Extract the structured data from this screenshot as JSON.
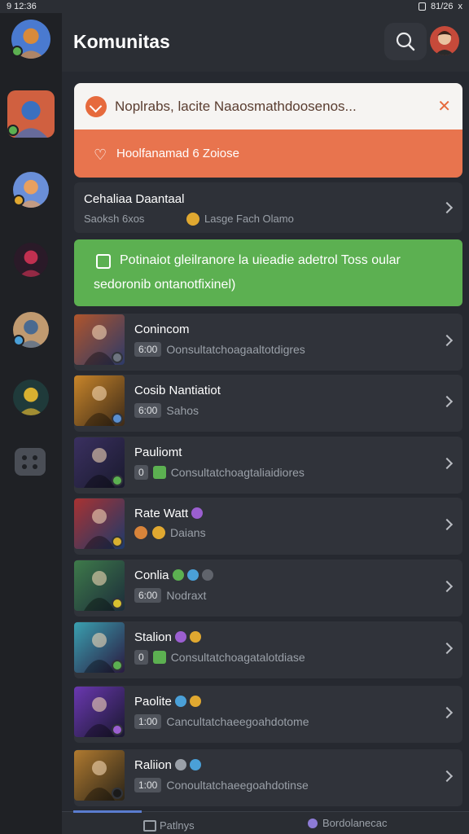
{
  "status_bar": {
    "time": "9 12:36",
    "right": "81/26",
    "close": "x"
  },
  "header": {
    "title": "Komunitas"
  },
  "banner": {
    "title": "Noplrabs, lacite Naaosmathdoosenos...",
    "close": "✕",
    "subtitle": "Hoolfanamad 6 Zoiose"
  },
  "featured": {
    "title": "Cehaliaa Daantaal",
    "meta_left": "Saoksh 6xos",
    "meta_right": "Lasge Fach Olamo"
  },
  "promo": {
    "line1": "Potinaiot gleilranore  la uieadie adetrol Toss oular",
    "line2": "sedoronib ontanotfixinel)"
  },
  "items": [
    {
      "name": "Conincom",
      "tag": "6:00",
      "sub": "Oonsultatchoagaaltotdigres",
      "thumb": "#b0552c",
      "thumb2": "#2c3a68",
      "badge": "#6e7580",
      "name_emojis": []
    },
    {
      "name": "Cosib Nantiatiot",
      "tag": "6:00",
      "sub": "Sahos",
      "thumb": "#c8852a",
      "thumb2": "#3c2a18",
      "badge": "#5a8fd0",
      "name_emojis": []
    },
    {
      "name": "Pauliomt",
      "tag": "0",
      "sub": "Consultatchoagtaliaidiores",
      "thumb": "#3a3060",
      "thumb2": "#1a1a2e",
      "badge": "#5cb051",
      "name_emojis": []
    },
    {
      "name": "Rate Watt",
      "tag": "",
      "sub": "Daians",
      "thumb": "#a83232",
      "thumb2": "#1d3a6a",
      "badge": "#d8b030",
      "name_emojis": [
        "#9b5fd0"
      ]
    },
    {
      "name": "Conlia",
      "tag": "6:00",
      "sub": "Nodraxt",
      "thumb": "#3e7a4a",
      "thumb2": "#1c2c3a",
      "badge": "#d8c030",
      "name_emojis": [
        "#5cb051",
        "#4aa0d8",
        "#60646c"
      ]
    },
    {
      "name": "Stalion",
      "tag": "0",
      "sub": "Consultatchoagatalotdiase",
      "thumb": "#3aa0b0",
      "thumb2": "#2a1a40",
      "badge": "#5cb051",
      "name_emojis": [
        "#9b5fd0",
        "#e0a830"
      ]
    },
    {
      "name": "Paolite",
      "tag": "1:00",
      "sub": "Cancultatchaeegoahdotome",
      "thumb": "#6a38b0",
      "thumb2": "#1a1830",
      "badge": "#9b5fd0",
      "name_emojis": [
        "#4aa0d8",
        "#e0a830"
      ]
    },
    {
      "name": "Raliion",
      "tag": "1:00",
      "sub": "Conoultatchaeegoahdotinse",
      "thumb": "#b07a30",
      "thumb2": "#2a2418",
      "badge": "#1a1a1a",
      "name_emojis": [
        "#9aa0a8",
        "#4aa0d8"
      ]
    }
  ],
  "bottom_bar": {
    "tab1": "Patlnys",
    "tab2": "Bordolanecac"
  },
  "rail": {
    "avatars": [
      {
        "color": "#4a7ad0",
        "accent": "#d88a3a",
        "badge": "#5cb051"
      },
      {
        "color": "#d06040",
        "accent": "#3a70c0",
        "badge": "#5cb051"
      },
      {
        "color": "#6a8fd8",
        "accent": "#e8a060",
        "badge": "#e0a830"
      },
      {
        "color": "#2a1a28",
        "accent": "#c03050",
        "badge": ""
      },
      {
        "color": "#c09a70",
        "accent": "#4a6a90",
        "badge": "#4aa0d8"
      },
      {
        "color": "#1f3a3a",
        "accent": "#d8b030",
        "badge": ""
      }
    ]
  },
  "colors": {
    "background": "#2b2e34",
    "rail": "#1f2125",
    "banner_orange": "#e8744e",
    "promo_green": "#5cb051"
  }
}
